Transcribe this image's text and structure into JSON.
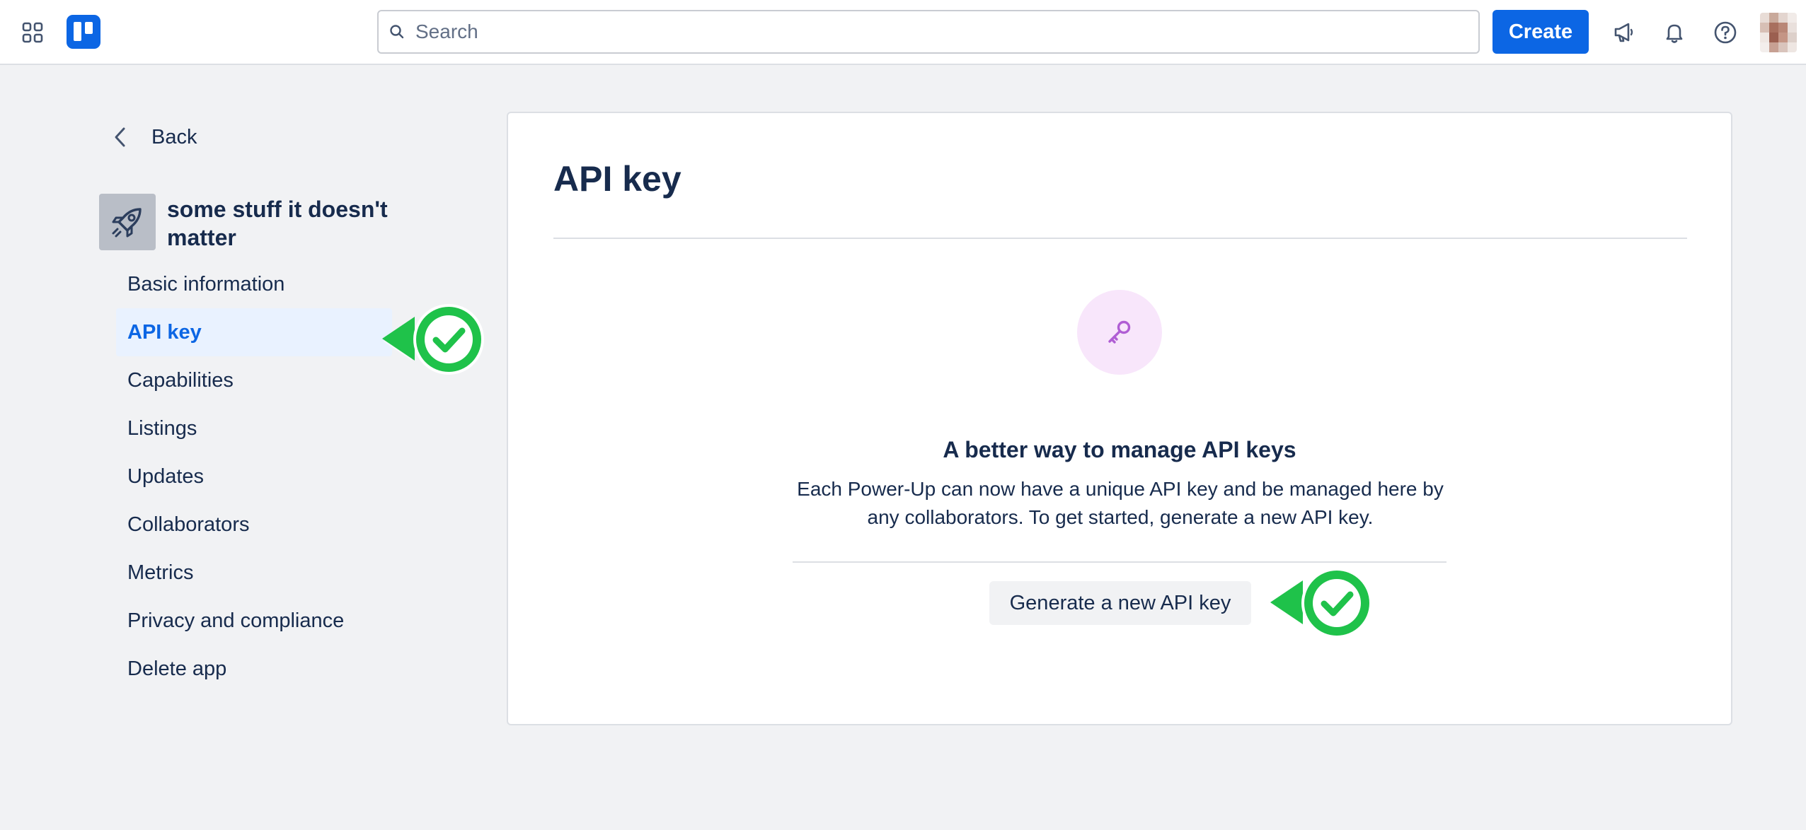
{
  "topbar": {
    "search_placeholder": "Search",
    "create_label": "Create",
    "icons": [
      "apps-grid-icon",
      "trello-logo",
      "search-icon",
      "megaphone-icon",
      "bell-icon",
      "help-icon",
      "avatar"
    ]
  },
  "sidebar": {
    "back_label": "Back",
    "app_name": "some stuff it doesn't matter",
    "items": [
      {
        "label": "Basic information",
        "active": false
      },
      {
        "label": "API key",
        "active": true
      },
      {
        "label": "Capabilities",
        "active": false
      },
      {
        "label": "Listings",
        "active": false
      },
      {
        "label": "Updates",
        "active": false
      },
      {
        "label": "Collaborators",
        "active": false
      },
      {
        "label": "Metrics",
        "active": false
      },
      {
        "label": "Privacy and compliance",
        "active": false
      },
      {
        "label": "Delete app",
        "active": false
      }
    ]
  },
  "main": {
    "title": "API key",
    "empty_state": {
      "heading": "A better way to manage API keys",
      "description": "Each Power-Up can now have a unique API key and be managed here by any collaborators. To get started, generate a new API key.",
      "button_label": "Generate a new API key"
    }
  },
  "colors": {
    "accent": "#0c66e4",
    "active_bg": "#e9f2ff",
    "check_green": "#1fc24a",
    "key_icon": "#b05ed4"
  }
}
